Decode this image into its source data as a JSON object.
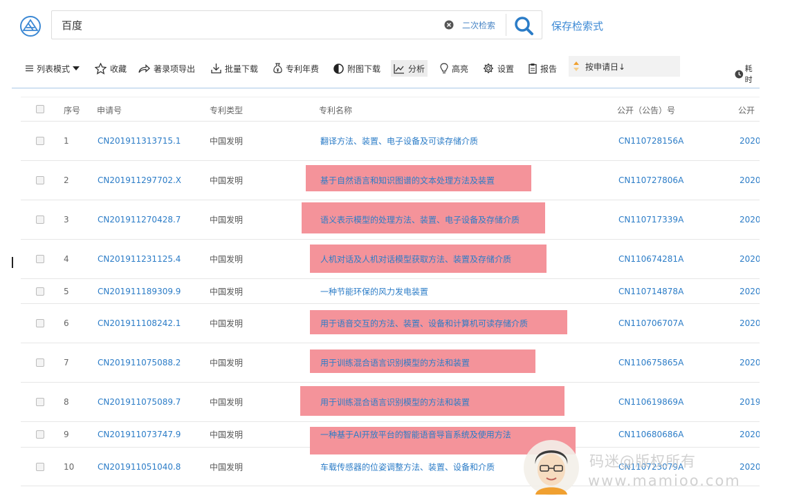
{
  "search": {
    "query": "百度",
    "secondary_search_label": "二次检索",
    "save_query_label": "保存检索式"
  },
  "toolbar": {
    "list_mode": "列表模式",
    "favorite": "收藏",
    "export": "著录项导出",
    "batch_download": "批量下载",
    "annual_fee": "专利年费",
    "figure_download": "附图下载",
    "analysis": "分析",
    "highlight": "高亮",
    "settings": "设置",
    "report": "报告",
    "sort": "按申请日↓",
    "time": "耗时"
  },
  "table": {
    "headers": {
      "no": "序号",
      "app_no": "申请号",
      "type": "专利类型",
      "title": "专利名称",
      "pub_no": "公开（公告）号",
      "pub_date": "公开"
    },
    "rows": [
      {
        "no": "1",
        "app_no": "CN201911313715.1",
        "type": "中国发明",
        "title": "翻译方法、装置、电子设备及可读存储介质",
        "pub_no": "CN110728156A",
        "date": "2020"
      },
      {
        "no": "2",
        "app_no": "CN201911297702.X",
        "type": "中国发明",
        "title": "基于自然语言和知识图谱的文本处理方法及装置",
        "pub_no": "CN110727806A",
        "date": "2020"
      },
      {
        "no": "3",
        "app_no": "CN201911270428.7",
        "type": "中国发明",
        "title": "语义表示模型的处理方法、装置、电子设备及存储介质",
        "pub_no": "CN110717339A",
        "date": "2020"
      },
      {
        "no": "4",
        "app_no": "CN201911231125.4",
        "type": "中国发明",
        "title": "人机对话及人机对话模型获取方法、装置及存储介质",
        "pub_no": "CN110674281A",
        "date": "2020"
      },
      {
        "no": "5",
        "app_no": "CN201911189309.9",
        "type": "中国发明",
        "title": "一种节能环保的风力发电装置",
        "pub_no": "CN110714878A",
        "date": "2020"
      },
      {
        "no": "6",
        "app_no": "CN201911108242.1",
        "type": "中国发明",
        "title": "用于语音交互的方法、装置、设备和计算机可读存储介质",
        "pub_no": "CN110706707A",
        "date": "2020"
      },
      {
        "no": "7",
        "app_no": "CN201911075088.2",
        "type": "中国发明",
        "title": "用于训练混合语言识别模型的方法和装置",
        "pub_no": "CN110675865A",
        "date": "2020"
      },
      {
        "no": "8",
        "app_no": "CN201911075089.7",
        "type": "中国发明",
        "title": "用于训练混合语言识别模型的方法和装置",
        "pub_no": "CN110619869A",
        "date": "2019"
      },
      {
        "no": "9",
        "app_no": "CN201911073747.9",
        "type": "中国发明",
        "title": "一种基于AI开放平台的智能语音导盲系统及使用方法",
        "pub_no": "CN110680686A",
        "date": "2020"
      },
      {
        "no": "10",
        "app_no": "CN201911051040.8",
        "type": "中国发明",
        "title": "车载传感器的位姿调整方法、装置、设备和介质",
        "pub_no": "CN110723079A",
        "date": "2020"
      }
    ]
  },
  "watermark": {
    "line1": "码迷@版权所有",
    "line2": "www.mamioo.com"
  },
  "colors": {
    "link": "#2b7cc7",
    "highlight": "#f4939a",
    "toolbar_border": "#a9c8e6"
  }
}
